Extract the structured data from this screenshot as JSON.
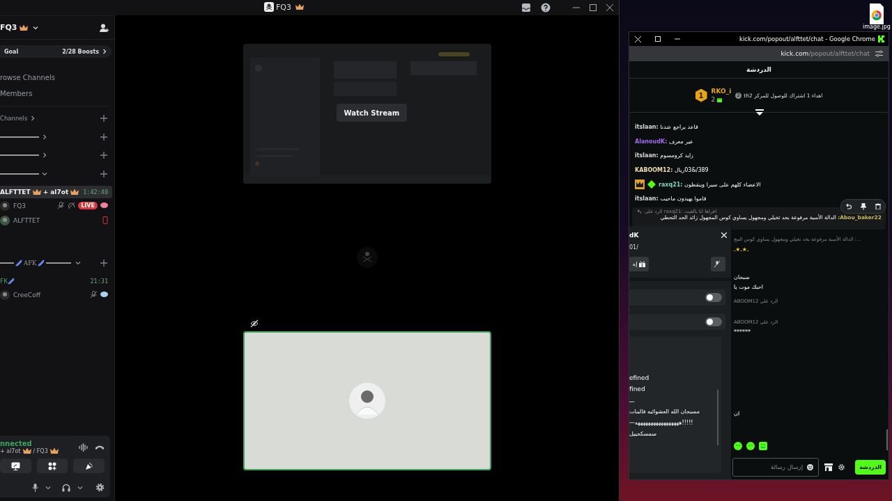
{
  "discord": {
    "title": "FQ3",
    "sidebar": {
      "server": "FQ3",
      "boost": {
        "label": "Goal",
        "count": "2/28 Boosts"
      },
      "nav": [
        "rowse Channels",
        "Members"
      ],
      "categories": [
        {
          "kind": "text",
          "label": "Channels",
          "expanded": false
        },
        {
          "kind": "redacted",
          "expanded": false
        },
        {
          "kind": "redacted",
          "expanded": false
        },
        {
          "kind": "redacted",
          "expanded": true
        }
      ],
      "voice_channel": {
        "host": "ALFTTET",
        "guest": "+ al7ot",
        "timer": "1:42:40",
        "selected": true,
        "members": [
          {
            "name": "FQ3",
            "muted": true,
            "deafened": true,
            "mobile": false,
            "activity": true,
            "color": "#f07fa0",
            "live": "LIVE"
          },
          {
            "name": "ALFTTET",
            "muted": false,
            "deafened": false,
            "mobile": true,
            "activity": false
          }
        ]
      },
      "afk_category": {
        "label": "AFK",
        "expanded": true
      },
      "afk_channel": {
        "name": "FK",
        "timer": "21:31",
        "selected": false,
        "members": [
          {
            "name": "CreeCoff",
            "muted": true,
            "deafened": false,
            "mobile": false,
            "activity": true,
            "color": "#a8d4f0"
          }
        ]
      },
      "voice_panel": {
        "status": "nnected",
        "channel": "+ al7ot",
        "server": "/ FQ3"
      }
    },
    "stage": {
      "watch_label": "Watch Stream"
    }
  },
  "desktop": {
    "icon_label": "image.jpg"
  },
  "chrome": {
    "title": "kick.com/popout/alfttet/chat - Google Chrome",
    "url_host": "kick.com",
    "url_path": "/popout/alfttet/chat",
    "chat_title": "الدردشة",
    "leader": {
      "rank": "1",
      "user": "RKO_i",
      "count": "2",
      "goal": "thاهداء 1 اشتراك للوصول للمركز 2",
      "goal_rank": "2"
    },
    "messages": [
      {
        "user": "itslaan:",
        "color": "#d9d9d9",
        "text": "قاعد يراجع عندنا"
      },
      {
        "user": "AlanoudK:",
        "color": "#a468f0",
        "text": "عير معرف"
      },
      {
        "user": "itslaan:",
        "color": "#d9d9d9",
        "text": "زايد كرومسوم"
      },
      {
        "user": "KABOOM12:",
        "color": "#f0dcb0",
        "text": "389/&03ريال"
      },
      {
        "user": "raxq21:",
        "color": "#7fd4c0",
        "text": "الاعضاء كلهم على سيرا وينقطون",
        "badges": [
          {
            "kind": "crown"
          },
          {
            "kind": "diamond"
          }
        ]
      },
      {
        "user": "itslaan:",
        "color": "#d9d9d9",
        "text": "قاموا يهيدون ماحيت"
      }
    ],
    "reply": {
      "context": "الرد على raxq21: افراها انا بالغيث",
      "user": "Abou_baker22:",
      "color": "#c8b860",
      "text": "الدالة الأسية مرفوعة بحد تخيلي ومجهول يساوي كوس المجهول زائد الحد التحطي"
    },
    "lower_messages": [
      {
        "kind": "context",
        "text": "...: الدالة الأسية مرفوعة بحد تخيلي ومجهول يساوي كوس المح"
      },
      {
        "kind": "stars",
        "text": "ـ★ـ★ـ"
      },
      {
        "kind": "plain",
        "text": "سبحان"
      },
      {
        "kind": "plain",
        "text": "احبك موت يا"
      },
      {
        "kind": "context",
        "text": "الرد على ABOOM12"
      },
      {
        "kind": "context",
        "text": "الرد على ABOOM12"
      },
      {
        "kind": "plain",
        "text": "******"
      },
      {
        "kind": "plain",
        "text": "ان"
      }
    ],
    "card": {
      "name": "dK",
      "line": "01/",
      "gift_label": "إه",
      "toggles": [
        {
          "on": false
        },
        {
          "on": false
        }
      ],
      "lines": [
        "efined",
        "fined",
        "ـــ",
        "مسبحان الله العشوائيه فالبنات",
        "!!!!!هههههههههههههههههه—",
        "سمسكحييل"
      ]
    },
    "input": {
      "placeholder": "إرسال رسالة"
    },
    "send_label": "الدردشة"
  }
}
